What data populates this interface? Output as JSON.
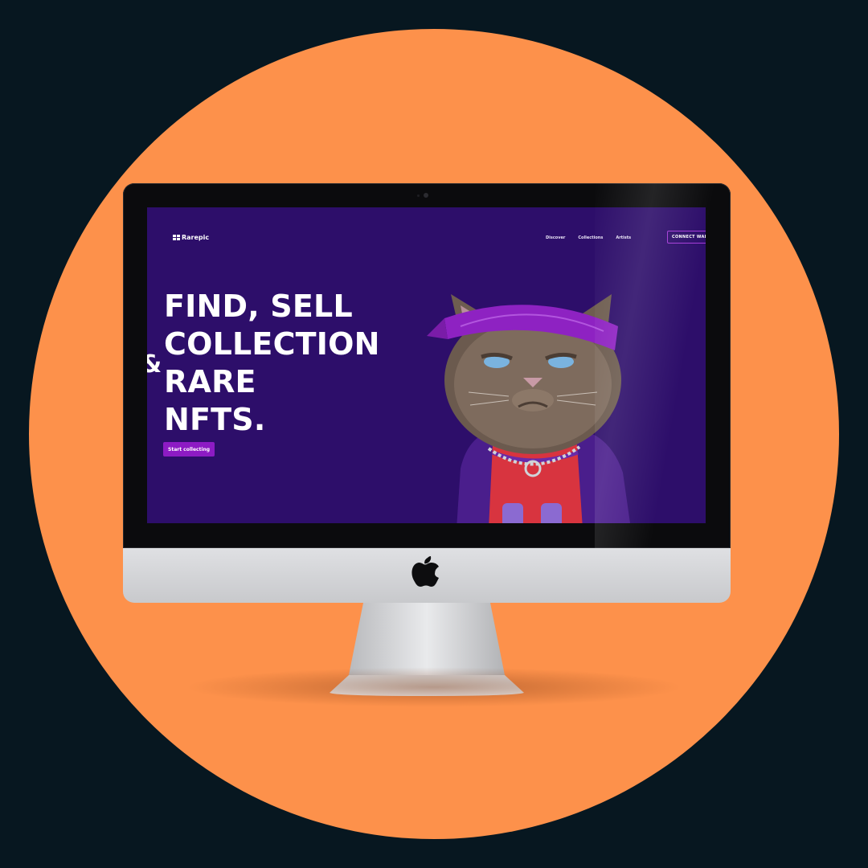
{
  "colors": {
    "background": "#071720",
    "circle": "#fd914b",
    "screen_bg": "#2d0e6a",
    "accent": "#8d1bc4"
  },
  "site": {
    "logo_text": "Rarepic",
    "nav": [
      "Discover",
      "Collections",
      "Artists"
    ],
    "connect_label": "CONNECT WAL",
    "headline_lines": [
      "FIND, SELL",
      "COLLECTION",
      "RARE",
      "NFTS."
    ],
    "amp": "&",
    "cta_label": "Start collecting"
  },
  "icons": {
    "device": "apple-icon",
    "hero": "cat-nft-illustration"
  }
}
